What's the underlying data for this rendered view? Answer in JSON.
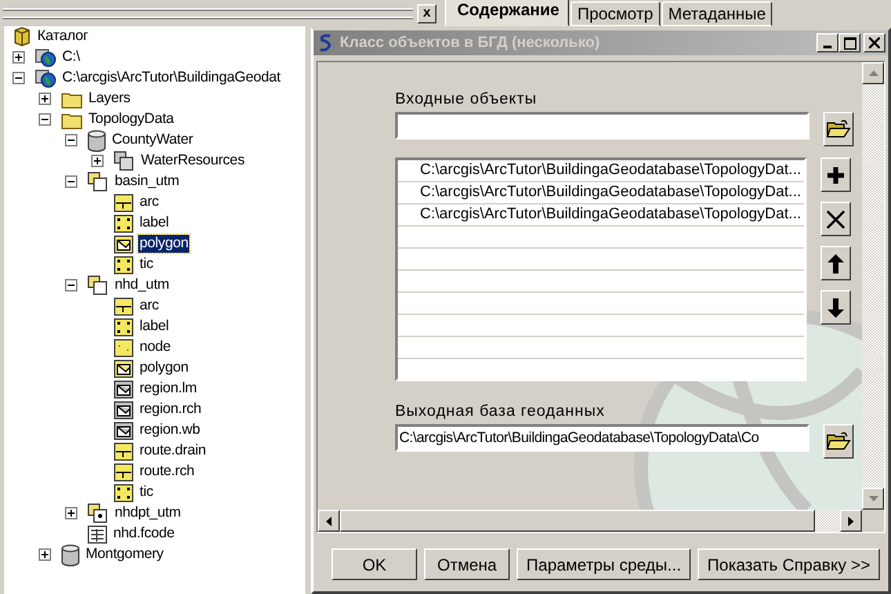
{
  "panel_close": "x",
  "catalog": {
    "tree": [
      {
        "label": "Каталог",
        "kind": "catalog",
        "selected": false,
        "children": [
          {
            "label": "C:\\",
            "kind": "drive",
            "selected": false,
            "expanded": false
          },
          {
            "label": "C:\\arcgis\\ArcTutor\\BuildingaGeodat",
            "kind": "drive",
            "selected": false,
            "expanded": true,
            "children": [
              {
                "label": "Layers",
                "kind": "folder",
                "selected": false,
                "expanded": false
              },
              {
                "label": "TopologyData",
                "kind": "folder",
                "selected": false,
                "expanded": true,
                "children": [
                  {
                    "label": "CountyWater",
                    "kind": "database",
                    "selected": false,
                    "expanded": true,
                    "children": [
                      {
                        "label": "WaterResources",
                        "kind": "dataset",
                        "selected": false,
                        "expanded": false
                      }
                    ]
                  },
                  {
                    "label": "basin_utm",
                    "kind": "coverage",
                    "selected": false,
                    "expanded": true,
                    "children": [
                      {
                        "label": "arc",
                        "kind": "arc",
                        "selected": false
                      },
                      {
                        "label": "label",
                        "kind": "label",
                        "selected": false
                      },
                      {
                        "label": "polygon",
                        "kind": "polygon",
                        "selected": true
                      },
                      {
                        "label": "tic",
                        "kind": "tic",
                        "selected": false
                      }
                    ]
                  },
                  {
                    "label": "nhd_utm",
                    "kind": "coverage",
                    "selected": false,
                    "expanded": true,
                    "children": [
                      {
                        "label": "arc",
                        "kind": "arc",
                        "selected": false
                      },
                      {
                        "label": "label",
                        "kind": "label",
                        "selected": false
                      },
                      {
                        "label": "node",
                        "kind": "node",
                        "selected": false
                      },
                      {
                        "label": "polygon",
                        "kind": "polygon",
                        "selected": false
                      },
                      {
                        "label": "region.lm",
                        "kind": "region",
                        "selected": false
                      },
                      {
                        "label": "region.rch",
                        "kind": "region",
                        "selected": false
                      },
                      {
                        "label": "region.wb",
                        "kind": "region",
                        "selected": false
                      },
                      {
                        "label": "route.drain",
                        "kind": "route",
                        "selected": false
                      },
                      {
                        "label": "route.rch",
                        "kind": "route",
                        "selected": false
                      },
                      {
                        "label": "tic",
                        "kind": "tic",
                        "selected": false
                      }
                    ]
                  },
                  {
                    "label": "nhdpt_utm",
                    "kind": "point-coverage",
                    "selected": false,
                    "expanded": false
                  },
                  {
                    "label": "nhd.fcode",
                    "kind": "table",
                    "selected": false
                  }
                ]
              },
              {
                "label": "Montgomery",
                "kind": "database",
                "selected": false,
                "expanded": false
              }
            ]
          }
        ]
      }
    ]
  },
  "tabs": [
    {
      "label": "Содержание",
      "selected": true
    },
    {
      "label": "Просмотр",
      "selected": false
    },
    {
      "label": "Метаданные",
      "selected": false
    }
  ],
  "dialog": {
    "title": "Класс объектов в БГД (несколько)",
    "input_label": "Входные объекты",
    "input_list": [
      "C:\\arcgis\\ArcTutor\\BuildingaGeodatabase\\TopologyDat...",
      "C:\\arcgis\\ArcTutor\\BuildingaGeodatabase\\TopologyDat...",
      "C:\\arcgis\\ArcTutor\\BuildingaGeodatabase\\TopologyDat..."
    ],
    "output_label": "Выходная база геоданных",
    "output_value": "C:\\arcgis\\ArcTutor\\BuildingaGeodatabase\\TopologyData\\Co",
    "buttons": [
      "OK",
      "Отмена",
      "Параметры среды...",
      "Показать Справку >>"
    ]
  }
}
